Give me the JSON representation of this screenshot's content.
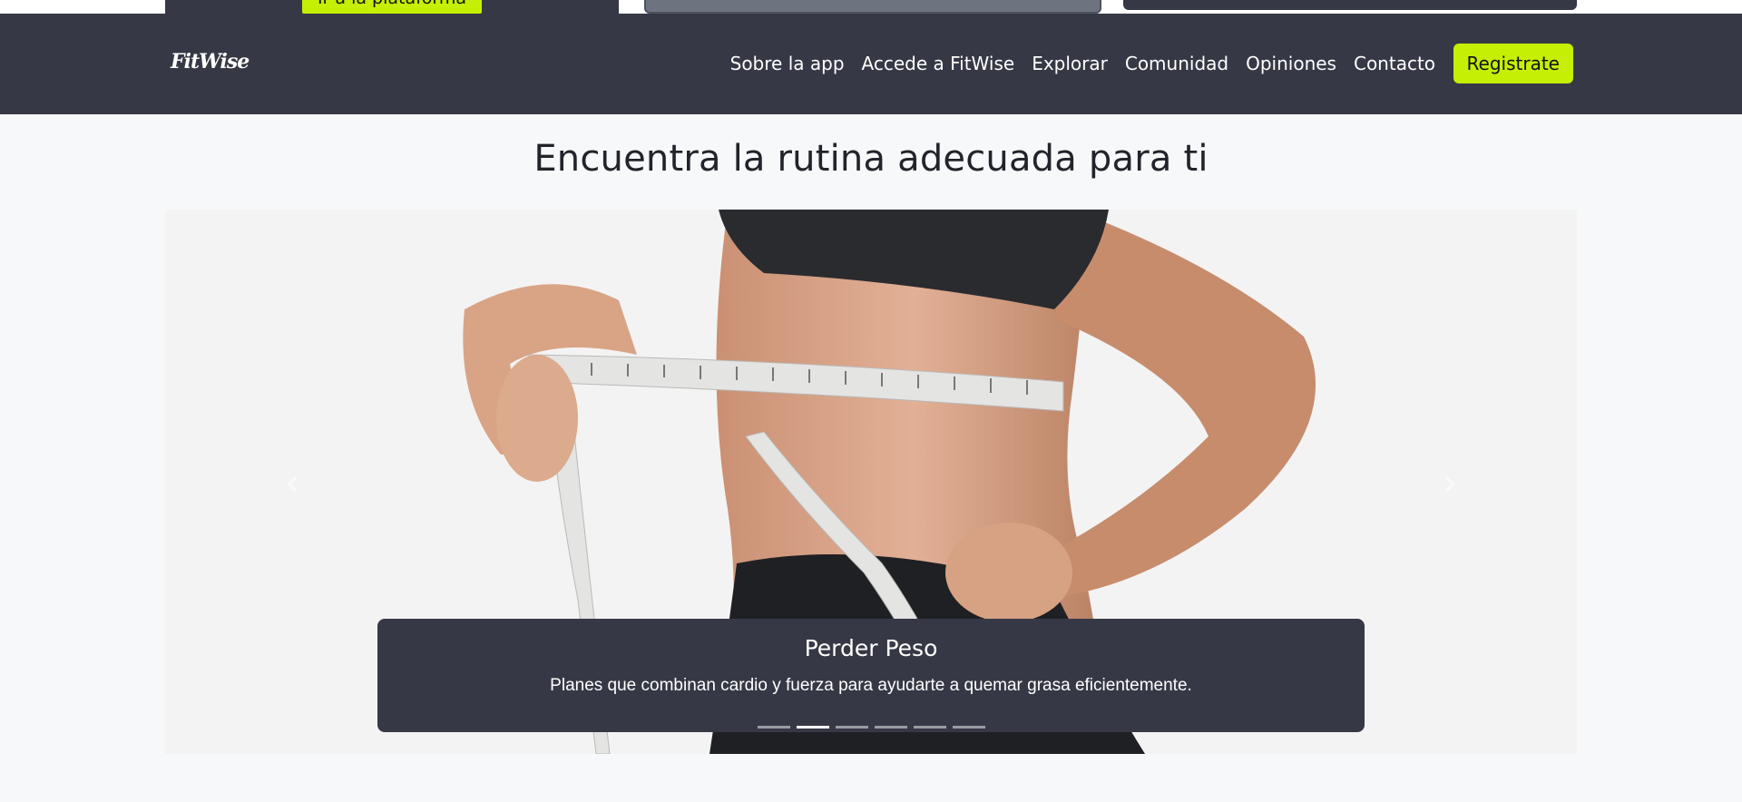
{
  "top_strip": {
    "cta_label": "Ir a la plataforma"
  },
  "navbar": {
    "brand": "FitWise",
    "links": [
      "Sobre la app",
      "Accede a FitWise",
      "Explorar",
      "Comunidad",
      "Opiniones",
      "Contacto"
    ],
    "register_label": "Registrate"
  },
  "section": {
    "title": "Encuentra la rutina adecuada para ti"
  },
  "carousel": {
    "caption_title": "Perder Peso",
    "caption_text": "Planes que combinan cardio y fuerza para ayudarte a quemar grasa eficientemente.",
    "indicator_count": 6,
    "active_index": 1,
    "prev_icon": "‹",
    "next_icon": "›"
  },
  "colors": {
    "navbar": "#363945",
    "accent": "#c5ef04",
    "background": "#f7f8fa"
  }
}
